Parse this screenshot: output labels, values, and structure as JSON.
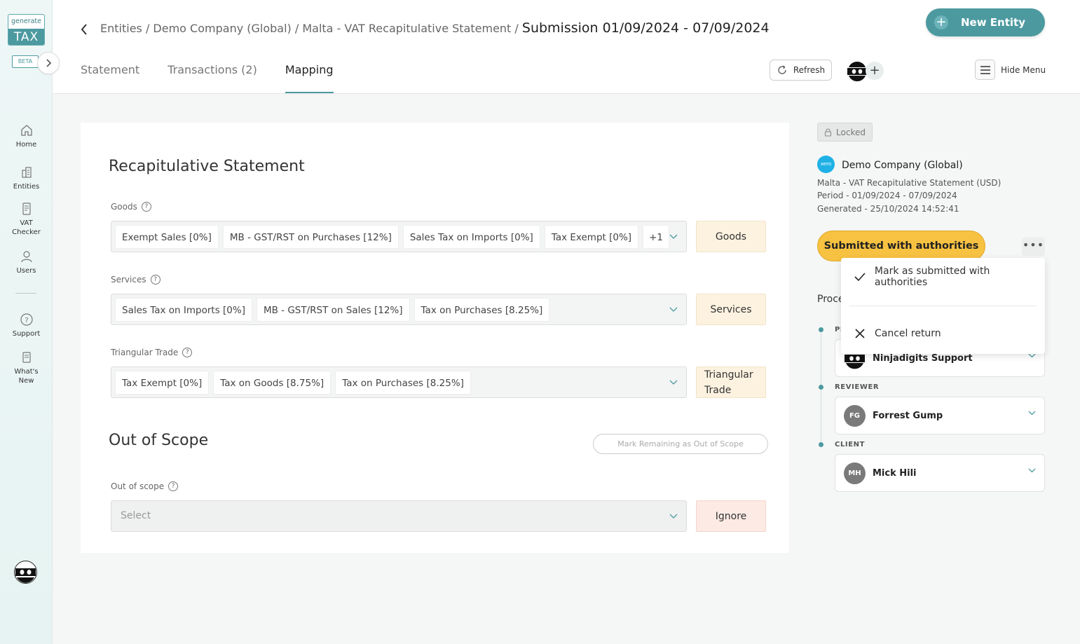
{
  "sidebar": {
    "logo_top": "generate",
    "logo_bottom": "TAX",
    "beta": "BETA",
    "expand_icon": "chevron-right-icon",
    "items": [
      {
        "label": "Home",
        "icon": "home-icon"
      },
      {
        "label": "Entities",
        "icon": "building-icon"
      },
      {
        "label": "VAT Checker",
        "icon": "document-icon"
      },
      {
        "label": "Users",
        "icon": "user-icon"
      },
      {
        "label": "Support",
        "icon": "help-icon"
      },
      {
        "label": "What's New",
        "icon": "news-icon"
      }
    ]
  },
  "header": {
    "breadcrumb": "Entities / Demo Company (Global) / Malta - VAT Recapitulative Statement / ",
    "breadcrumb_current": "Submission 01/09/2024 - 07/09/2024",
    "tabs": [
      {
        "label": "Statement",
        "active": false
      },
      {
        "label": "Transactions (2)",
        "active": false
      },
      {
        "label": "Mapping",
        "active": true
      }
    ],
    "refresh_label": "Refresh",
    "new_entity_label": "New Entity",
    "hide_menu_label": "Hide Menu"
  },
  "main": {
    "recap_title": "Recapitulative Statement",
    "goods": {
      "label": "Goods",
      "chips": [
        "Exempt Sales [0%]",
        "MB - GST/RST on Purchases [12%]",
        "Sales Tax on Imports [0%]",
        "Tax Exempt [0%]",
        "+1"
      ],
      "tag": "Goods"
    },
    "services": {
      "label": "Services",
      "chips": [
        "Sales Tax on Imports [0%]",
        "MB - GST/RST on Sales [12%]",
        "Tax on Purchases [8.25%]"
      ],
      "tag": "Services"
    },
    "triangular": {
      "label": "Triangular Trade",
      "chips": [
        "Tax Exempt [0%]",
        "Tax on Goods [8.75%]",
        "Tax on Purchases [8.25%]"
      ],
      "tag_line1": "Triangular",
      "tag_line2": "Trade"
    },
    "out_of_scope_title": "Out of Scope",
    "mark_remaining_label": "Mark Remaining as Out of Scope",
    "out_of_scope": {
      "label": "Out of scope",
      "placeholder": "Select",
      "tag": "Ignore"
    }
  },
  "panel": {
    "locked_label": "Locked",
    "xero_label": "xero",
    "company": "Demo Company (Global)",
    "meta_line1": "Malta - VAT Recapitulative Statement (USD)",
    "meta_line2": "Period - 01/09/2024 - 07/09/2024",
    "meta_line3": "Generated - 25/10/2024 14:52:41",
    "status_label": "Submitted with authorities",
    "more_label": "•••",
    "process_label": "Proce",
    "preparer_label": "PI",
    "preparer_name": "Ninjadigits Support",
    "reviewer_label": "REVIEWER",
    "reviewer_initials": "FG",
    "reviewer_name": "Forrest Gump",
    "client_label": "CLIENT",
    "client_initials": "MH",
    "client_name": "Mick Hili"
  },
  "menu": {
    "item1": "Mark as submitted with authorities",
    "item2": "Cancel return"
  },
  "colors": {
    "accent": "#4c9aa0",
    "status": "#f7c141",
    "tag_bg": "#fdf2e0",
    "ignore_bg": "#fdeae4"
  }
}
